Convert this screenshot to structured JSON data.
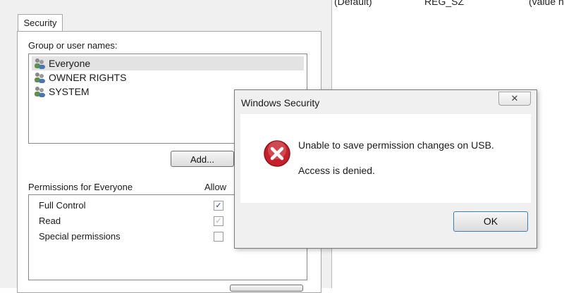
{
  "background_list": {
    "name_cell": "(Default)",
    "type_cell": "REG_SZ",
    "data_cell": "(value n"
  },
  "security_window": {
    "tab_label": "Security",
    "group_label": "Group or user names:",
    "users": [
      {
        "name": "Everyone",
        "selected": true
      },
      {
        "name": "OWNER RIGHTS",
        "selected": false
      },
      {
        "name": "SYSTEM",
        "selected": false
      }
    ],
    "add_button": "Add...",
    "permissions_label": "Permissions for Everyone",
    "allow_header": "Allow",
    "permissions": [
      {
        "name": "Full Control",
        "allow": "checked"
      },
      {
        "name": "Read",
        "allow": "checked-disabled"
      },
      {
        "name": "Special permissions",
        "allow": "unchecked"
      }
    ]
  },
  "dialog": {
    "title": "Windows Security",
    "close_glyph": "✕",
    "message": "Unable to save permission changes on USB.",
    "detail": "Access is denied.",
    "ok_button": "OK",
    "icon": "error-icon"
  },
  "colors": {
    "error_red": "#c8202a",
    "selection": "#e3e3e3",
    "window_bg": "#f0f0f0"
  }
}
